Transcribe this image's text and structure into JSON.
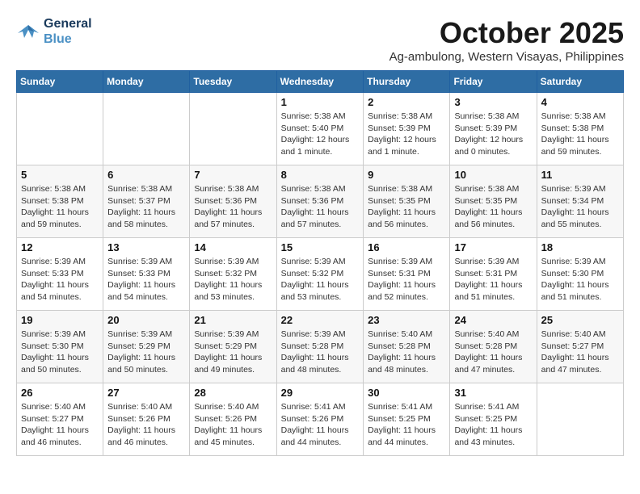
{
  "header": {
    "logo_line1": "General",
    "logo_line2": "Blue",
    "month": "October 2025",
    "location": "Ag-ambulong, Western Visayas, Philippines"
  },
  "weekdays": [
    "Sunday",
    "Monday",
    "Tuesday",
    "Wednesday",
    "Thursday",
    "Friday",
    "Saturday"
  ],
  "weeks": [
    [
      {
        "day": "",
        "info": ""
      },
      {
        "day": "",
        "info": ""
      },
      {
        "day": "",
        "info": ""
      },
      {
        "day": "1",
        "info": "Sunrise: 5:38 AM\nSunset: 5:40 PM\nDaylight: 12 hours\nand 1 minute."
      },
      {
        "day": "2",
        "info": "Sunrise: 5:38 AM\nSunset: 5:39 PM\nDaylight: 12 hours\nand 1 minute."
      },
      {
        "day": "3",
        "info": "Sunrise: 5:38 AM\nSunset: 5:39 PM\nDaylight: 12 hours\nand 0 minutes."
      },
      {
        "day": "4",
        "info": "Sunrise: 5:38 AM\nSunset: 5:38 PM\nDaylight: 11 hours\nand 59 minutes."
      }
    ],
    [
      {
        "day": "5",
        "info": "Sunrise: 5:38 AM\nSunset: 5:38 PM\nDaylight: 11 hours\nand 59 minutes."
      },
      {
        "day": "6",
        "info": "Sunrise: 5:38 AM\nSunset: 5:37 PM\nDaylight: 11 hours\nand 58 minutes."
      },
      {
        "day": "7",
        "info": "Sunrise: 5:38 AM\nSunset: 5:36 PM\nDaylight: 11 hours\nand 57 minutes."
      },
      {
        "day": "8",
        "info": "Sunrise: 5:38 AM\nSunset: 5:36 PM\nDaylight: 11 hours\nand 57 minutes."
      },
      {
        "day": "9",
        "info": "Sunrise: 5:38 AM\nSunset: 5:35 PM\nDaylight: 11 hours\nand 56 minutes."
      },
      {
        "day": "10",
        "info": "Sunrise: 5:38 AM\nSunset: 5:35 PM\nDaylight: 11 hours\nand 56 minutes."
      },
      {
        "day": "11",
        "info": "Sunrise: 5:39 AM\nSunset: 5:34 PM\nDaylight: 11 hours\nand 55 minutes."
      }
    ],
    [
      {
        "day": "12",
        "info": "Sunrise: 5:39 AM\nSunset: 5:33 PM\nDaylight: 11 hours\nand 54 minutes."
      },
      {
        "day": "13",
        "info": "Sunrise: 5:39 AM\nSunset: 5:33 PM\nDaylight: 11 hours\nand 54 minutes."
      },
      {
        "day": "14",
        "info": "Sunrise: 5:39 AM\nSunset: 5:32 PM\nDaylight: 11 hours\nand 53 minutes."
      },
      {
        "day": "15",
        "info": "Sunrise: 5:39 AM\nSunset: 5:32 PM\nDaylight: 11 hours\nand 53 minutes."
      },
      {
        "day": "16",
        "info": "Sunrise: 5:39 AM\nSunset: 5:31 PM\nDaylight: 11 hours\nand 52 minutes."
      },
      {
        "day": "17",
        "info": "Sunrise: 5:39 AM\nSunset: 5:31 PM\nDaylight: 11 hours\nand 51 minutes."
      },
      {
        "day": "18",
        "info": "Sunrise: 5:39 AM\nSunset: 5:30 PM\nDaylight: 11 hours\nand 51 minutes."
      }
    ],
    [
      {
        "day": "19",
        "info": "Sunrise: 5:39 AM\nSunset: 5:30 PM\nDaylight: 11 hours\nand 50 minutes."
      },
      {
        "day": "20",
        "info": "Sunrise: 5:39 AM\nSunset: 5:29 PM\nDaylight: 11 hours\nand 50 minutes."
      },
      {
        "day": "21",
        "info": "Sunrise: 5:39 AM\nSunset: 5:29 PM\nDaylight: 11 hours\nand 49 minutes."
      },
      {
        "day": "22",
        "info": "Sunrise: 5:39 AM\nSunset: 5:28 PM\nDaylight: 11 hours\nand 48 minutes."
      },
      {
        "day": "23",
        "info": "Sunrise: 5:40 AM\nSunset: 5:28 PM\nDaylight: 11 hours\nand 48 minutes."
      },
      {
        "day": "24",
        "info": "Sunrise: 5:40 AM\nSunset: 5:28 PM\nDaylight: 11 hours\nand 47 minutes."
      },
      {
        "day": "25",
        "info": "Sunrise: 5:40 AM\nSunset: 5:27 PM\nDaylight: 11 hours\nand 47 minutes."
      }
    ],
    [
      {
        "day": "26",
        "info": "Sunrise: 5:40 AM\nSunset: 5:27 PM\nDaylight: 11 hours\nand 46 minutes."
      },
      {
        "day": "27",
        "info": "Sunrise: 5:40 AM\nSunset: 5:26 PM\nDaylight: 11 hours\nand 46 minutes."
      },
      {
        "day": "28",
        "info": "Sunrise: 5:40 AM\nSunset: 5:26 PM\nDaylight: 11 hours\nand 45 minutes."
      },
      {
        "day": "29",
        "info": "Sunrise: 5:41 AM\nSunset: 5:26 PM\nDaylight: 11 hours\nand 44 minutes."
      },
      {
        "day": "30",
        "info": "Sunrise: 5:41 AM\nSunset: 5:25 PM\nDaylight: 11 hours\nand 44 minutes."
      },
      {
        "day": "31",
        "info": "Sunrise: 5:41 AM\nSunset: 5:25 PM\nDaylight: 11 hours\nand 43 minutes."
      },
      {
        "day": "",
        "info": ""
      }
    ]
  ]
}
